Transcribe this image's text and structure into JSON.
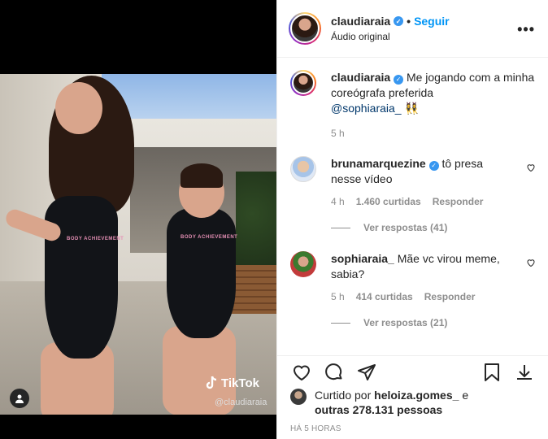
{
  "post": {
    "username": "claudiaraia",
    "follow_label": "Seguir",
    "audio_label": "Áudio original",
    "more_label": "•••"
  },
  "caption": {
    "username": "claudiaraia",
    "text": "Me jogando com a minha coreógrafa preferida",
    "mention": "@sophiaraia_",
    "emoji": "👯‍♀️",
    "time": "5 h"
  },
  "video": {
    "watermark_brand": "TikTok",
    "watermark_handle": "@claudiaraia",
    "suit_text": "BODY ACHIEVEMENT"
  },
  "comments": [
    {
      "username": "brunamarquezine",
      "text": "tô presa nesse vídeo",
      "time": "4 h",
      "likes": "1.460 curtidas",
      "reply_label": "Responder",
      "view_replies": "Ver respostas (41)"
    },
    {
      "username": "sophiaraia_",
      "text": "Mãe vc virou meme, sabia?",
      "time": "5 h",
      "likes": "414 curtidas",
      "reply_label": "Responder",
      "view_replies": "Ver respostas (21)"
    }
  ],
  "likes": {
    "prefix": "Curtido por",
    "user": "heloiza.gomes_",
    "and": "e",
    "others": "outras 278.131 pessoas"
  },
  "timestamp": "HÁ 5 HORAS",
  "colors": {
    "accent": "#0095f6",
    "verified": "#3897f0",
    "muted": "#8e8e8e"
  }
}
